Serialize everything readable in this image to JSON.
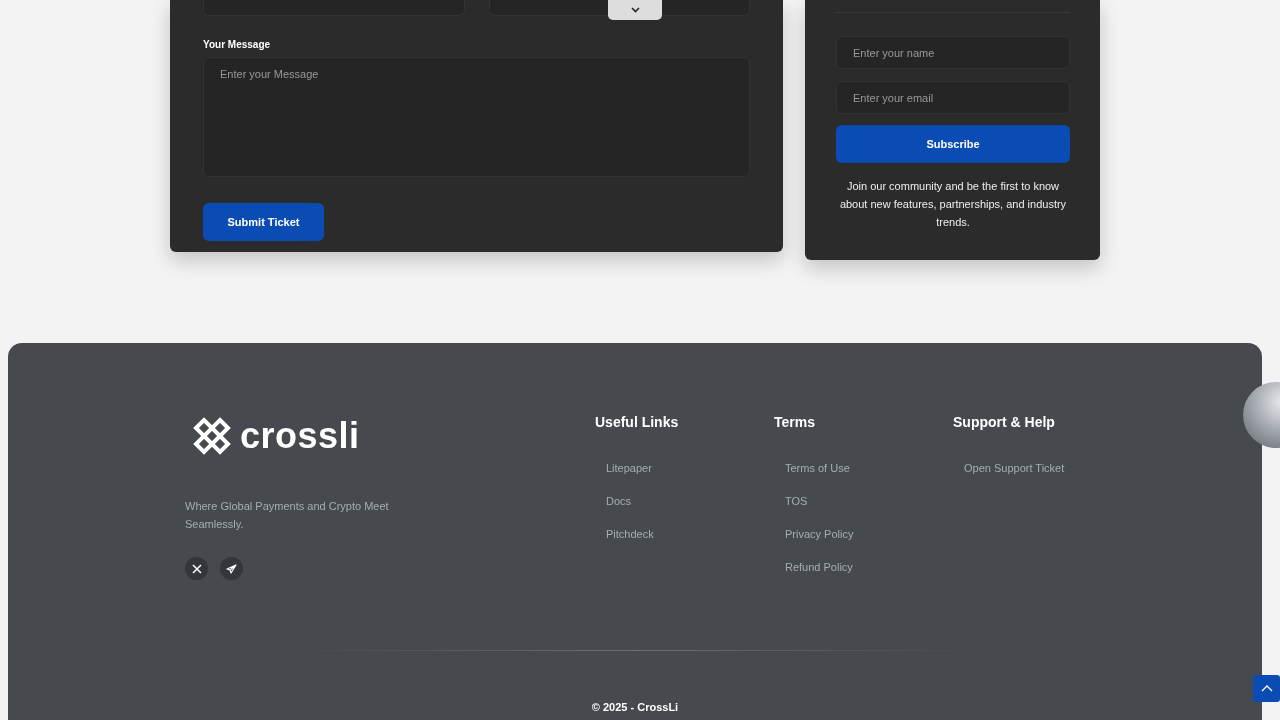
{
  "ticket_form": {
    "message_label": "Your Message",
    "message_placeholder": "Enter your Message",
    "submit": "Submit Ticket"
  },
  "newsletter": {
    "name_placeholder": "Enter your name",
    "email_placeholder": "Enter your email",
    "subscribe": "Subscribe",
    "note": "Join our community and be the first to know about new features, partnerships, and industry trends."
  },
  "footer": {
    "brand": "crossli",
    "tagline": "Where Global Payments and Crypto Meet Seamlessly.",
    "columns": [
      {
        "title": "Useful Links",
        "links": [
          "Litepaper",
          "Docs",
          "Pitchdeck"
        ]
      },
      {
        "title": "Terms",
        "links": [
          "Terms of Use",
          "TOS",
          "Privacy Policy",
          "Refund Policy"
        ]
      },
      {
        "title": "Support & Help",
        "links": [
          "Open Support Ticket"
        ]
      }
    ],
    "copyright": "© 2025 - CrossLi"
  }
}
